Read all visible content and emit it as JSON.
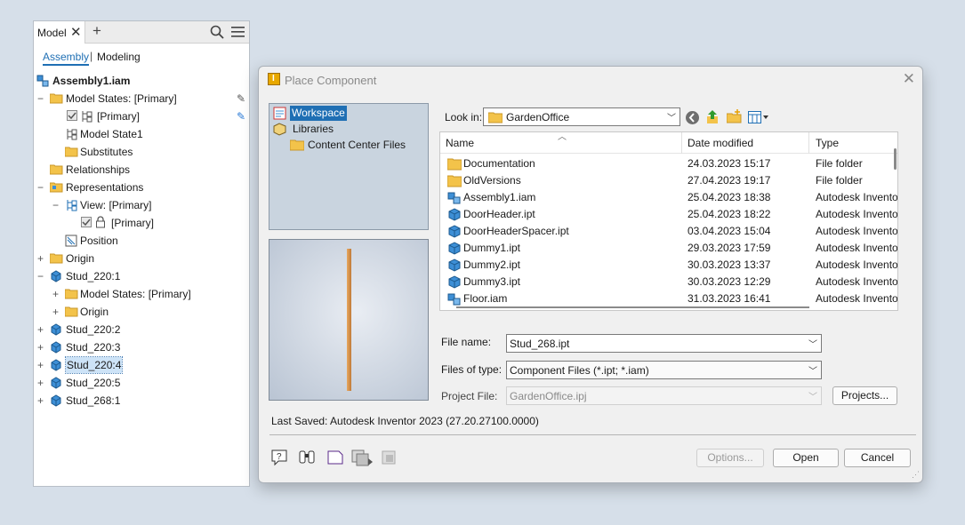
{
  "browser": {
    "tab_label": "Model",
    "subtabs": {
      "assembly": "Assembly",
      "modeling": "Modeling"
    },
    "root": "Assembly1.iam",
    "tree": [
      {
        "label": "Model States: [Primary]",
        "expander": "−"
      },
      {
        "label": "[Primary]",
        "expander": ""
      },
      {
        "label": "Model State1",
        "expander": ""
      },
      {
        "label": "Substitutes",
        "expander": ""
      },
      {
        "label": "Relationships",
        "expander": ""
      },
      {
        "label": "Representations",
        "expander": "−"
      },
      {
        "label": "View: [Primary]",
        "expander": "−"
      },
      {
        "label": "[Primary]",
        "expander": ""
      },
      {
        "label": "Position",
        "expander": ""
      },
      {
        "label": "Origin",
        "expander": "+"
      },
      {
        "label": "Stud_220:1",
        "expander": "−"
      },
      {
        "label": "Model States: [Primary]",
        "expander": "+"
      },
      {
        "label": "Origin",
        "expander": "+"
      },
      {
        "label": "Stud_220:2",
        "expander": "+"
      },
      {
        "label": "Stud_220:3",
        "expander": "+"
      },
      {
        "label": "Stud_220:4",
        "expander": "+"
      },
      {
        "label": "Stud_220:5",
        "expander": "+"
      },
      {
        "label": "Stud_268:1",
        "expander": "+"
      }
    ]
  },
  "dialog": {
    "title": "Place Component",
    "locations": [
      "Workspace",
      "Libraries",
      "Content Center Files"
    ],
    "look_in_label": "Look in:",
    "look_in_value": "GardenOffice",
    "columns": {
      "name": "Name",
      "date": "Date modified",
      "type": "Type"
    },
    "files": [
      {
        "name": "Documentation",
        "date": "24.03.2023 15:17",
        "type": "File folder"
      },
      {
        "name": "OldVersions",
        "date": "27.04.2023 19:17",
        "type": "File folder"
      },
      {
        "name": "Assembly1.iam",
        "date": "25.04.2023 18:38",
        "type": "Autodesk Invento"
      },
      {
        "name": "DoorHeader.ipt",
        "date": "25.04.2023 18:22",
        "type": "Autodesk Invento"
      },
      {
        "name": "DoorHeaderSpacer.ipt",
        "date": "03.04.2023 15:04",
        "type": "Autodesk Invento"
      },
      {
        "name": "Dummy1.ipt",
        "date": "29.03.2023 17:59",
        "type": "Autodesk Invento"
      },
      {
        "name": "Dummy2.ipt",
        "date": "30.03.2023 13:37",
        "type": "Autodesk Invento"
      },
      {
        "name": "Dummy3.ipt",
        "date": "30.03.2023 12:29",
        "type": "Autodesk Invento"
      },
      {
        "name": "Floor.iam",
        "date": "31.03.2023 16:41",
        "type": "Autodesk Invento"
      }
    ],
    "file_name_label": "File name:",
    "file_name_value": "Stud_268.ipt",
    "file_type_label": "Files of type:",
    "file_type_value": "Component Files (*.ipt; *.iam)",
    "project_label": "Project File:",
    "project_value": "GardenOffice.ipj",
    "projects_button": "Projects...",
    "last_saved": "Last Saved: Autodesk Inventor 2023 (27.20.27100.0000)",
    "options_button": "Options...",
    "open_button": "Open",
    "cancel_button": "Cancel"
  },
  "colors": {
    "accent": "#1f6fb4",
    "folder": "#f3c34a",
    "part_blue": "#3d8fd6",
    "selection": "#cde3f7"
  }
}
